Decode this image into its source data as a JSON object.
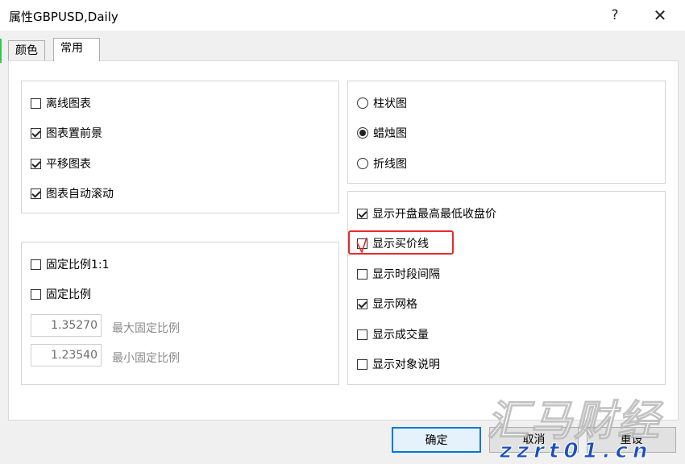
{
  "window": {
    "title": "属性GBPUSD,Daily",
    "help_label": "?",
    "close_label": "✕"
  },
  "tabs": [
    {
      "label": "颜色",
      "active": false
    },
    {
      "label": "常用",
      "active": true
    }
  ],
  "chart_options": [
    {
      "label": "离线图表",
      "checked": false
    },
    {
      "label": "图表置前景",
      "checked": true
    },
    {
      "label": "平移图表",
      "checked": true
    },
    {
      "label": "图表自动滚动",
      "checked": true
    }
  ],
  "scale_options": [
    {
      "label": "固定比例1:1",
      "checked": false
    },
    {
      "label": "固定比例",
      "checked": false
    }
  ],
  "ratio_fields": [
    {
      "value": "1.35270",
      "label": "最大固定比例"
    },
    {
      "value": "1.23540",
      "label": "最小固定比例"
    }
  ],
  "chart_types": [
    {
      "label": "柱状图",
      "selected": false
    },
    {
      "label": "蜡烛图",
      "selected": true
    },
    {
      "label": "折线图",
      "selected": false
    }
  ],
  "display_options": [
    {
      "label": "显示开盘最高最低收盘价",
      "checked": true
    },
    {
      "label": "显示买价线",
      "checked": false
    },
    {
      "label": "显示时段间隔",
      "checked": false
    },
    {
      "label": "显示网格",
      "checked": true
    },
    {
      "label": "显示成交量",
      "checked": false
    },
    {
      "label": "显示对象说明",
      "checked": false
    }
  ],
  "buttons": {
    "ok": "确定",
    "cancel": "取消",
    "reset": "重设"
  },
  "watermark": {
    "brand": "汇马财经",
    "url": "zzrt01.cn"
  },
  "colors": {
    "highlight": "#e52b2b",
    "accent": "#0078d7"
  }
}
